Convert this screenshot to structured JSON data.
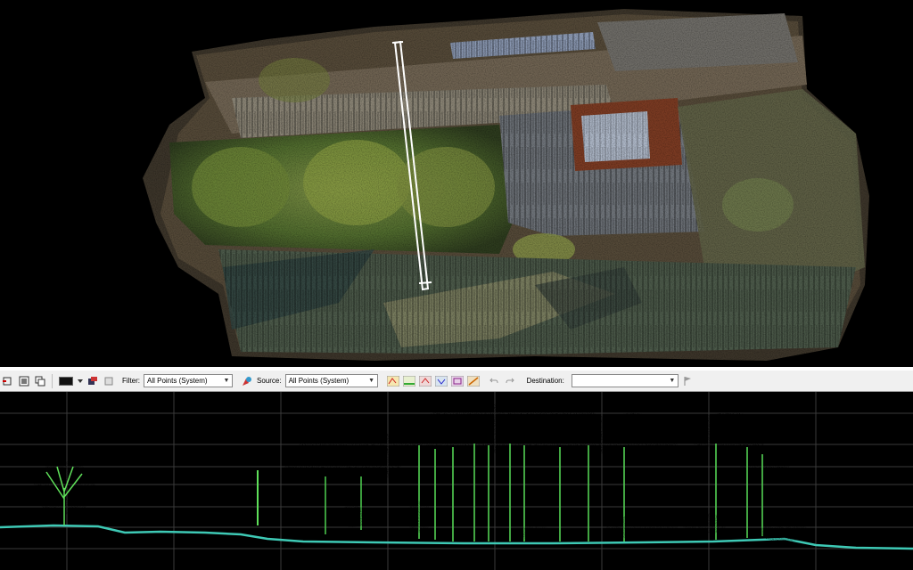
{
  "toolbar": {
    "filter_label": "Filter:",
    "filter_value": "All Points (System)",
    "source_label": "Source:",
    "source_value": "All Points (System)",
    "destination_label": "Destination:",
    "destination_value": ""
  },
  "icons": [
    "cursor-icon",
    "zoom-extent-icon",
    "copy-view-icon",
    "color-swatch-icon",
    "dropdown-icon",
    "profile-icon",
    "classify-icon",
    "classify-points-icon",
    "undo-icon",
    "redo-icon",
    "flag-icon"
  ],
  "colors": {
    "background": "#000000",
    "toolbar": "#f0f0f0",
    "profile_ground": "#3ec9b5",
    "canopy_high": "#ff5a1a",
    "canopy_mid": "#f3d51c",
    "canopy_low": "#46c84a"
  }
}
